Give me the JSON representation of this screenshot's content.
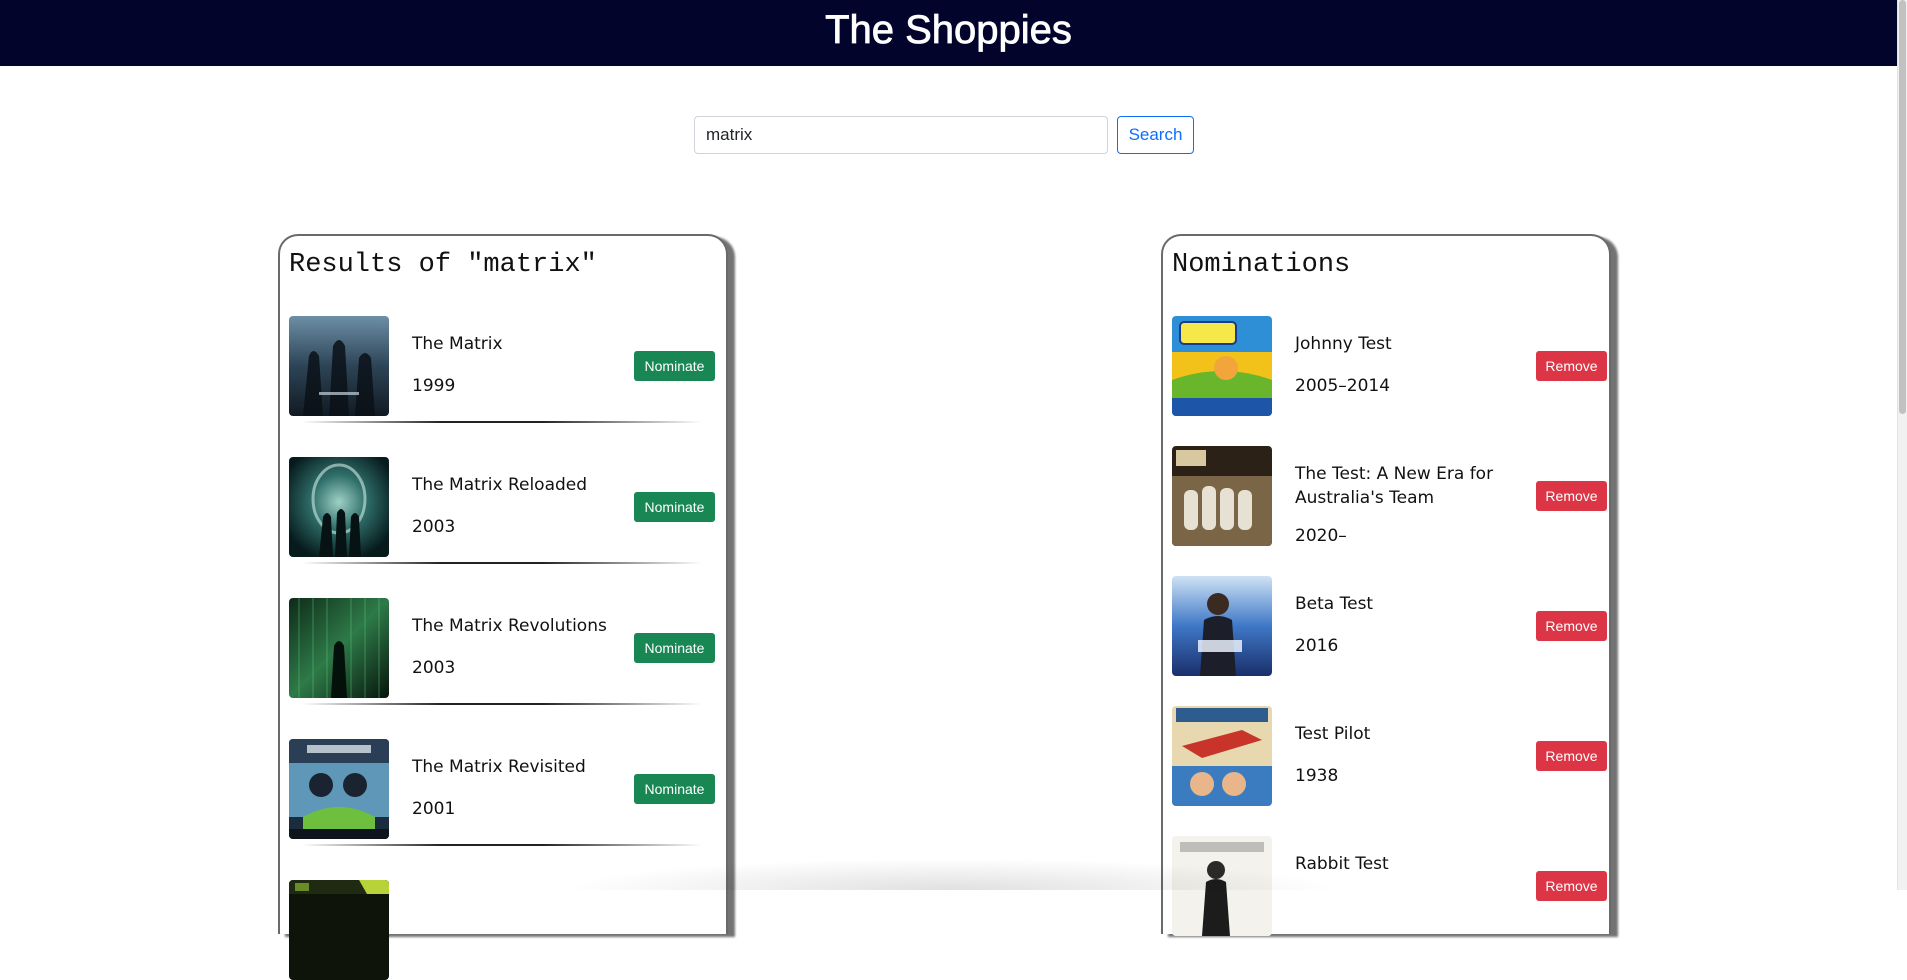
{
  "app": {
    "title": "The Shoppies"
  },
  "search": {
    "value": "matrix",
    "button_label": "Search"
  },
  "results": {
    "heading": "Results of \"matrix\"",
    "action_label": "Nominate",
    "items": [
      {
        "title": "The Matrix",
        "year": "1999"
      },
      {
        "title": "The Matrix Reloaded",
        "year": "2003"
      },
      {
        "title": "The Matrix Revolutions",
        "year": "2003"
      },
      {
        "title": "The Matrix Revisited",
        "year": "2001"
      }
    ]
  },
  "nominations": {
    "heading": "Nominations",
    "action_label": "Remove",
    "items": [
      {
        "title": "Johnny Test",
        "year": "2005–2014"
      },
      {
        "title": "The Test: A New Era for Australia's Team",
        "year": "2020–"
      },
      {
        "title": "Beta Test",
        "year": "2016"
      },
      {
        "title": "Test Pilot",
        "year": "1938"
      },
      {
        "title": "Rabbit Test"
      }
    ]
  },
  "colors": {
    "header_bg": "#02042c",
    "nominate_green": "#198754",
    "remove_red": "#dc3545",
    "search_blue": "#0d6efd"
  }
}
